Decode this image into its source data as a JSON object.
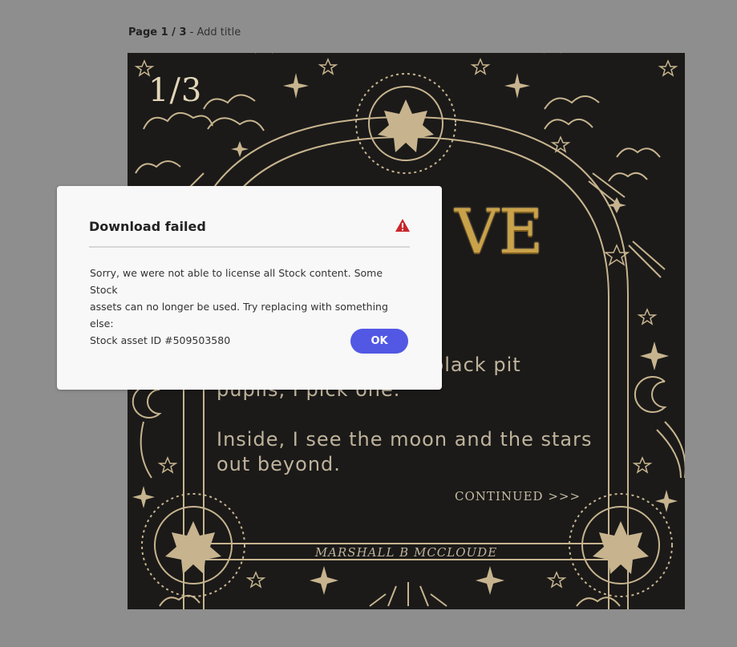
{
  "header": {
    "page_label": "Page 1 / 3",
    "separator": " - ",
    "add_title": "Add title"
  },
  "canvas": {
    "page_counter": "1/3",
    "title_fragment": "VE",
    "body_line_1a": "black pit",
    "body_line_1b": "pupils, I pick one.",
    "body_line_2a": "Inside, I see the moon and the stars",
    "body_line_2b": "out beyond.",
    "continued": "CONTINUED >>>",
    "author": "MARSHALL B MCCLOUDE"
  },
  "dialog": {
    "title": "Download failed",
    "message_line_1": "Sorry, we were not able to license all Stock content. Some Stock",
    "message_line_2": "assets can no longer be used. Try replacing with something else:",
    "message_line_3": "Stock asset ID #509503580",
    "ok_label": "OK",
    "alert_icon": "alert-triangle-icon"
  },
  "colors": {
    "backdrop": "#8e8e8e",
    "canvas_bg": "#1b1a19",
    "ornament": "#c7b48e",
    "title_gold": "#c9a24a",
    "alert_red": "#c9252c",
    "button_blue": "#5258e4"
  }
}
